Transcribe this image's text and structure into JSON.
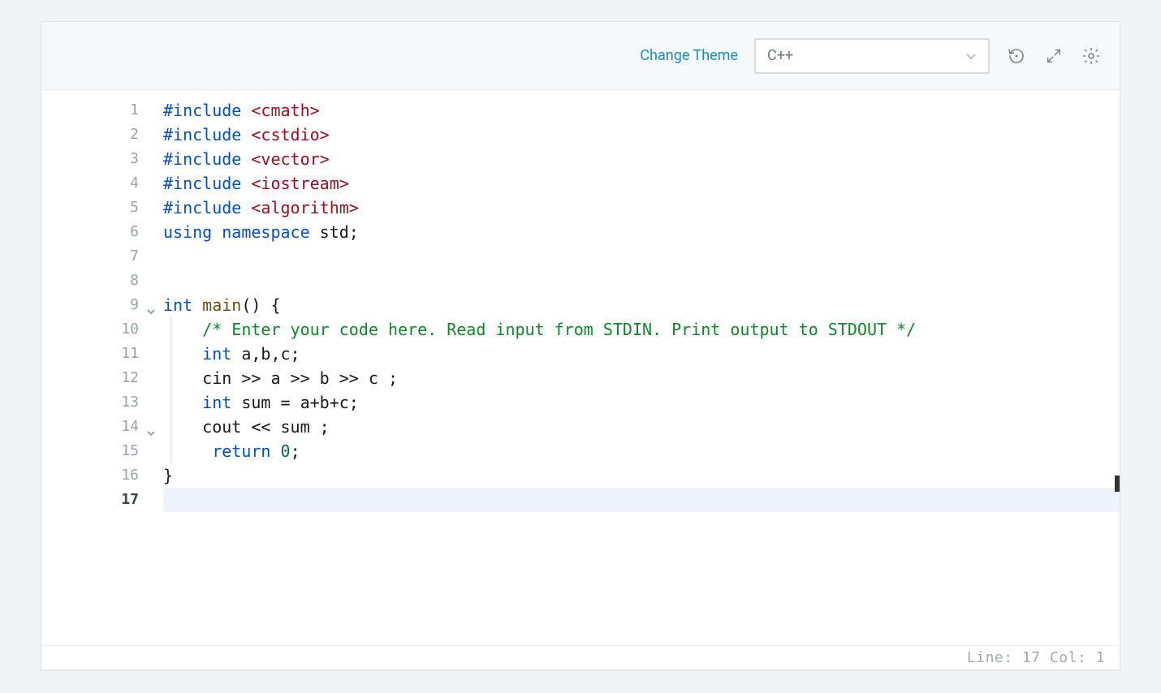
{
  "toolbar": {
    "change_theme": "Change Theme",
    "language": "C++"
  },
  "gutter": {
    "lines": [
      "1",
      "2",
      "3",
      "4",
      "5",
      "6",
      "7",
      "8",
      "9",
      "10",
      "11",
      "12",
      "13",
      "14",
      "15",
      "16",
      "17"
    ],
    "folds": {
      "9": true,
      "14": true
    },
    "active_line": "17"
  },
  "code": {
    "lines": [
      [
        {
          "c": "tok-kw",
          "t": "#include"
        },
        {
          "c": "tok-plain",
          "t": " "
        },
        {
          "c": "tok-inc",
          "t": "<cmath>"
        }
      ],
      [
        {
          "c": "tok-kw",
          "t": "#include"
        },
        {
          "c": "tok-plain",
          "t": " "
        },
        {
          "c": "tok-inc",
          "t": "<cstdio>"
        }
      ],
      [
        {
          "c": "tok-kw",
          "t": "#include"
        },
        {
          "c": "tok-plain",
          "t": " "
        },
        {
          "c": "tok-inc",
          "t": "<vector>"
        }
      ],
      [
        {
          "c": "tok-kw",
          "t": "#include"
        },
        {
          "c": "tok-plain",
          "t": " "
        },
        {
          "c": "tok-inc",
          "t": "<iostream>"
        }
      ],
      [
        {
          "c": "tok-kw",
          "t": "#include"
        },
        {
          "c": "tok-plain",
          "t": " "
        },
        {
          "c": "tok-inc",
          "t": "<algorithm>"
        }
      ],
      [
        {
          "c": "tok-kw",
          "t": "using"
        },
        {
          "c": "tok-plain",
          "t": " "
        },
        {
          "c": "tok-kw",
          "t": "namespace"
        },
        {
          "c": "tok-plain",
          "t": " std;"
        }
      ],
      [],
      [],
      [
        {
          "c": "tok-kw",
          "t": "int"
        },
        {
          "c": "tok-plain",
          "t": " "
        },
        {
          "c": "tok-fn",
          "t": "main"
        },
        {
          "c": "tok-plain",
          "t": "() {"
        }
      ],
      [
        {
          "c": "tok-plain",
          "t": "    "
        },
        {
          "c": "tok-comment",
          "t": "/* Enter your code here. Read input from STDIN. Print output to STDOUT */"
        }
      ],
      [
        {
          "c": "tok-plain",
          "t": "    "
        },
        {
          "c": "tok-kw",
          "t": "int"
        },
        {
          "c": "tok-plain",
          "t": " a,b,c;"
        }
      ],
      [
        {
          "c": "tok-plain",
          "t": "    cin >> a >> b >> c ;"
        }
      ],
      [
        {
          "c": "tok-plain",
          "t": "    "
        },
        {
          "c": "tok-kw",
          "t": "int"
        },
        {
          "c": "tok-plain",
          "t": " sum = a+b+c;"
        }
      ],
      [
        {
          "c": "tok-plain",
          "t": "    cout << sum ;"
        }
      ],
      [
        {
          "c": "tok-plain",
          "t": "     "
        },
        {
          "c": "tok-kw",
          "t": "return"
        },
        {
          "c": "tok-plain",
          "t": " "
        },
        {
          "c": "tok-num",
          "t": "0"
        },
        {
          "c": "tok-plain",
          "t": ";"
        }
      ],
      [
        {
          "c": "tok-plain",
          "t": "}"
        }
      ],
      []
    ],
    "indent_guides": [
      10,
      11,
      12,
      13,
      14,
      15
    ]
  },
  "status": {
    "line_label": "Line:",
    "line_value": "17",
    "col_label": "Col:",
    "col_value": "1"
  }
}
